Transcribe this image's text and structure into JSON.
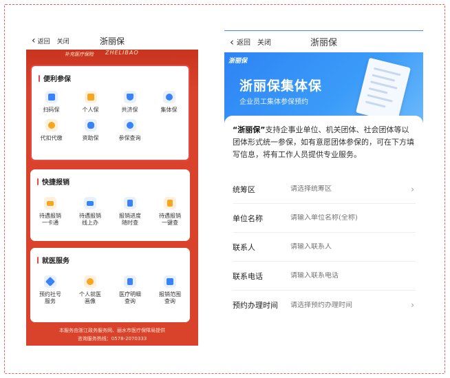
{
  "left": {
    "nav": {
      "back": "返回",
      "close": "关闭",
      "title": "浙丽保"
    },
    "brand": {
      "org": "补充医疗保险",
      "name": "ZHELIBAO"
    },
    "sections": [
      {
        "title": "便利参保",
        "items": [
          {
            "label": "扫码保",
            "icon": "qr-code-icon",
            "color": "#3a82f7"
          },
          {
            "label": "个人保",
            "icon": "wallet-icon",
            "color": "#f5a623"
          },
          {
            "label": "共济保",
            "icon": "shield-icon",
            "color": "#3a82f7"
          },
          {
            "label": "集体保",
            "icon": "group-icon",
            "color": "#3a82f7"
          },
          {
            "label": "代扣代缴",
            "icon": "coin-icon",
            "color": "#f5a623"
          },
          {
            "label": "资助保",
            "icon": "handshake-icon",
            "color": "#3a82f7"
          },
          {
            "label": "参保查询",
            "icon": "search-icon",
            "color": "#3a82f7"
          }
        ]
      },
      {
        "title": "快捷报销",
        "items": [
          {
            "label": "待遇报销",
            "label2": "一卡通",
            "icon": "card-icon",
            "color": "#f5a623"
          },
          {
            "label": "待遇报销",
            "label2": "线上办",
            "icon": "monitor-icon",
            "color": "#3a82f7"
          },
          {
            "label": "报销进度",
            "label2": "随时查",
            "icon": "document-icon",
            "color": "#3a82f7"
          },
          {
            "label": "待遇报销",
            "label2": "一键查",
            "icon": "receipt-icon",
            "color": "#f5a623"
          }
        ]
      },
      {
        "title": "就医服务",
        "items": [
          {
            "label": "预约社号",
            "label2": "服务",
            "icon": "medical-cross-icon",
            "color": "#3a82f7"
          },
          {
            "label": "个人就医",
            "label2": "画像",
            "icon": "person-icon",
            "color": "#f5a623"
          },
          {
            "label": "医疗明细",
            "label2": "查询",
            "icon": "list-icon",
            "color": "#3a82f7"
          },
          {
            "label": "报销范围",
            "label2": "查询",
            "icon": "scope-icon",
            "color": "#3a82f7"
          }
        ]
      }
    ],
    "footer": {
      "line1": "本服务由浙江政务服务网、丽水市医疗保障局提供",
      "line2": "咨询服务热线：0578-2070333"
    }
  },
  "right": {
    "nav": {
      "back": "返回",
      "close": "关闭",
      "title": "浙丽保"
    },
    "banner": {
      "logo": "浙丽保",
      "headline": "浙丽保集体保",
      "subline": "企业员工集体参保预约"
    },
    "intro_brand": "“浙丽保”",
    "intro_rest": "支持企事业单位、机关团体、社会团体等以团体形式统一参保，如有意愿团体参保的，可在下方填写信息，将有工作人员提供专业服务。",
    "form": [
      {
        "label": "统筹区",
        "placeholder": "请选择统筹区",
        "arrow": true
      },
      {
        "label": "单位名称",
        "placeholder": "请输入单位名称(全称)",
        "arrow": false
      },
      {
        "label": "联系人",
        "placeholder": "请输入联系人",
        "arrow": false
      },
      {
        "label": "联系电话",
        "placeholder": "请输入联系电话",
        "arrow": false
      },
      {
        "label": "预约办理时间",
        "placeholder": "请选择预约办理时间",
        "arrow": true
      }
    ]
  }
}
